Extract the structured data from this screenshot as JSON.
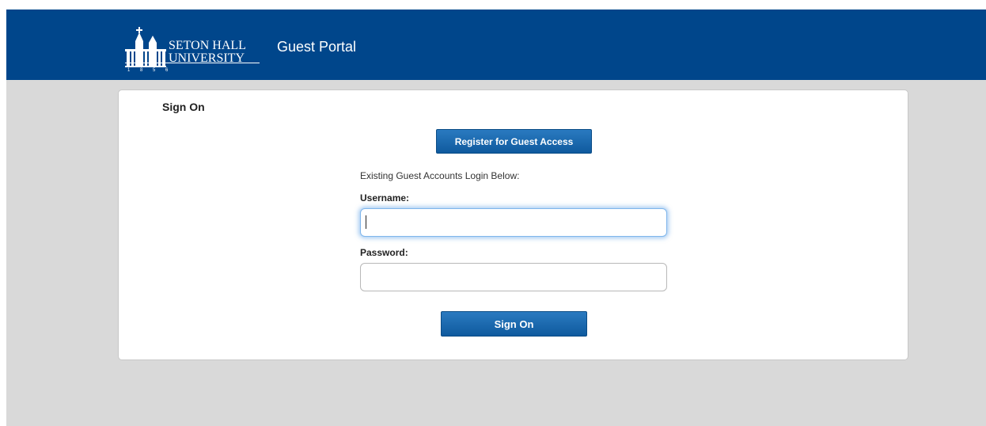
{
  "header": {
    "logo": {
      "name_line1": "SETON HALL",
      "name_line2": "UNIVERSITY",
      "year_digits": [
        "1",
        "8",
        "5",
        "6"
      ]
    },
    "portal_title": "Guest Portal"
  },
  "card": {
    "title": "Sign On",
    "register_button": "Register for Guest Access",
    "help_text": "Existing Guest Accounts Login Below:",
    "username_label": "Username:",
    "username_value": "",
    "password_label": "Password:",
    "password_value": "",
    "signon_button": "Sign On"
  },
  "colors": {
    "header_bg": "#00468b",
    "page_bg": "#d9d9d9",
    "button_bg": "#1565a8",
    "focus_glow": "#5ca0e6"
  }
}
